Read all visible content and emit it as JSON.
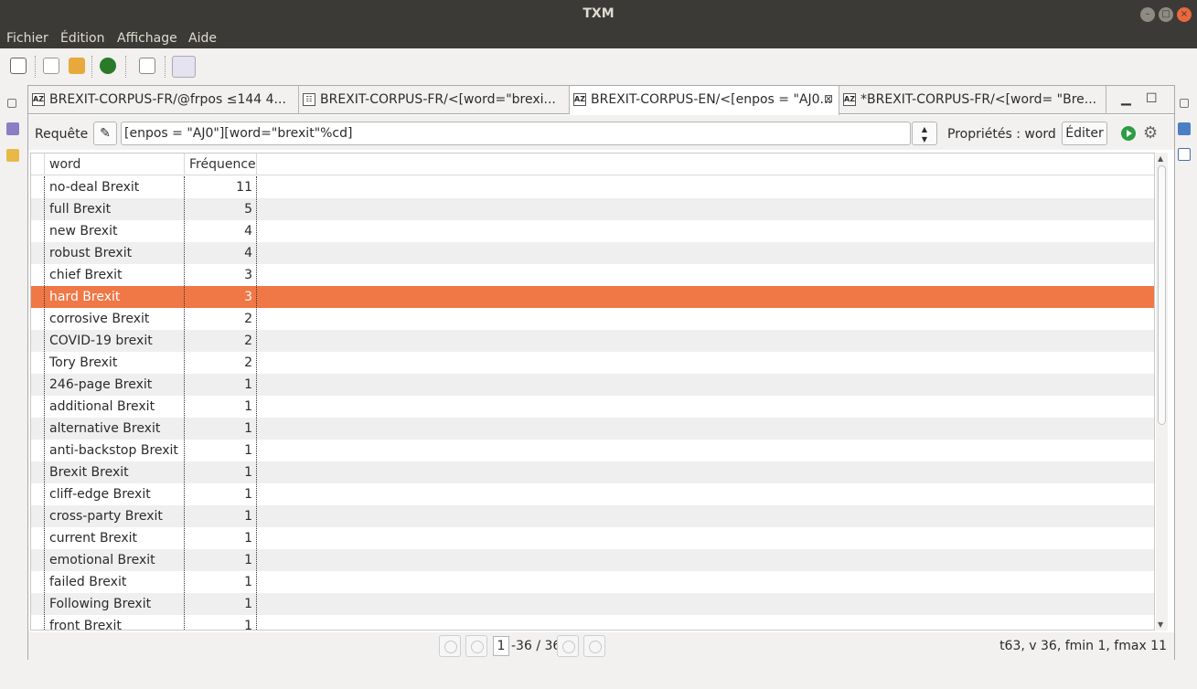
{
  "window": {
    "title": "TXM"
  },
  "menu": [
    "Fichier",
    "Édition",
    "Affichage",
    "Aide"
  ],
  "tabs": [
    {
      "label": "BREXIT-CORPUS-FR/@frpos ≤144 4...",
      "icon": "AZ",
      "active": false
    },
    {
      "label": "BREXIT-CORPUS-FR/<[word=\"brexi...",
      "icon": "☷",
      "active": false
    },
    {
      "label": "BREXIT-CORPUS-EN/<[enpos = \"AJ0...",
      "icon": "AZ",
      "active": true
    },
    {
      "label": "*BREXIT-CORPUS-FR/<[word= \"Bre...",
      "icon": "AZ",
      "active": false
    }
  ],
  "query": {
    "label": "Requête",
    "value": "[enpos = \"AJ0\"][word=\"brexit\"%cd]",
    "properties_label": "Propriétés : word",
    "edit_label": "Éditer"
  },
  "table": {
    "headers": [
      "word",
      "Fréquence"
    ],
    "rows": [
      {
        "word": "no-deal Brexit",
        "freq": "11"
      },
      {
        "word": "full Brexit",
        "freq": "5"
      },
      {
        "word": "new Brexit",
        "freq": "4"
      },
      {
        "word": "robust Brexit",
        "freq": "4"
      },
      {
        "word": "chief Brexit",
        "freq": "3"
      },
      {
        "word": "hard Brexit",
        "freq": "3",
        "selected": true
      },
      {
        "word": "corrosive Brexit",
        "freq": "2"
      },
      {
        "word": "COVID-19 brexit",
        "freq": "2"
      },
      {
        "word": "Tory Brexit",
        "freq": "2"
      },
      {
        "word": "246-page Brexit",
        "freq": "1"
      },
      {
        "word": "additional Brexit",
        "freq": "1"
      },
      {
        "word": "alternative Brexit",
        "freq": "1"
      },
      {
        "word": "anti-backstop Brexit",
        "freq": "1"
      },
      {
        "word": "Brexit Brexit",
        "freq": "1"
      },
      {
        "word": "cliff-edge Brexit",
        "freq": "1"
      },
      {
        "word": "cross-party Brexit",
        "freq": "1"
      },
      {
        "word": "current Brexit",
        "freq": "1"
      },
      {
        "word": "emotional Brexit",
        "freq": "1"
      },
      {
        "word": "failed Brexit",
        "freq": "1"
      },
      {
        "word": "Following Brexit",
        "freq": "1"
      },
      {
        "word": "front Brexit",
        "freq": "1"
      }
    ]
  },
  "pager": {
    "current": "1",
    "total": "-36 / 36",
    "stats": "t63, v 36, fmin 1, fmax 11"
  },
  "colors": {
    "selection": "#f07746",
    "titlebar": "#3b3a36",
    "close": "#e9683e"
  }
}
